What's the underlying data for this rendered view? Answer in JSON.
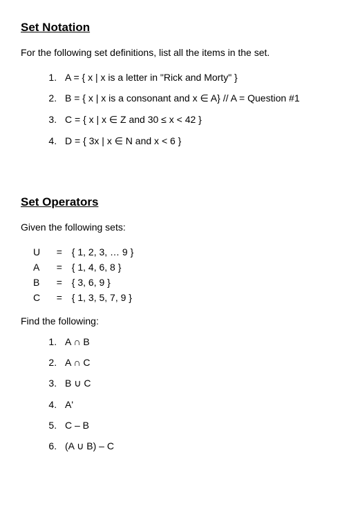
{
  "section1": {
    "heading": "Set Notation",
    "intro": "For the following set definitions, list all the items in the set.",
    "items": [
      "A = { x | x is a letter in \"Rick and Morty\" }",
      "B = { x |  x is a consonant and x ∈ A}    // A = Question #1",
      "C = { x | x ∈ Z and 30 ≤ x < 42 }",
      "D = { 3x | x ∈ N and x < 6 }"
    ]
  },
  "section2": {
    "heading": "Set Operators",
    "intro": "Given the following sets:",
    "defs": [
      {
        "name": "U",
        "val": "{ 1, 2, 3, … 9 }"
      },
      {
        "name": "A",
        "val": "{ 1, 4, 6, 8 }"
      },
      {
        "name": "B",
        "val": "{ 3, 6, 9 }"
      },
      {
        "name": "C",
        "val": "{ 1, 3, 5, 7, 9 }"
      }
    ],
    "find": "Find the following:",
    "ops": [
      "A ∩ B",
      "A ∩ C",
      "B ∪ C",
      "A'",
      "C – B",
      "(A ∪ B) – C"
    ]
  }
}
